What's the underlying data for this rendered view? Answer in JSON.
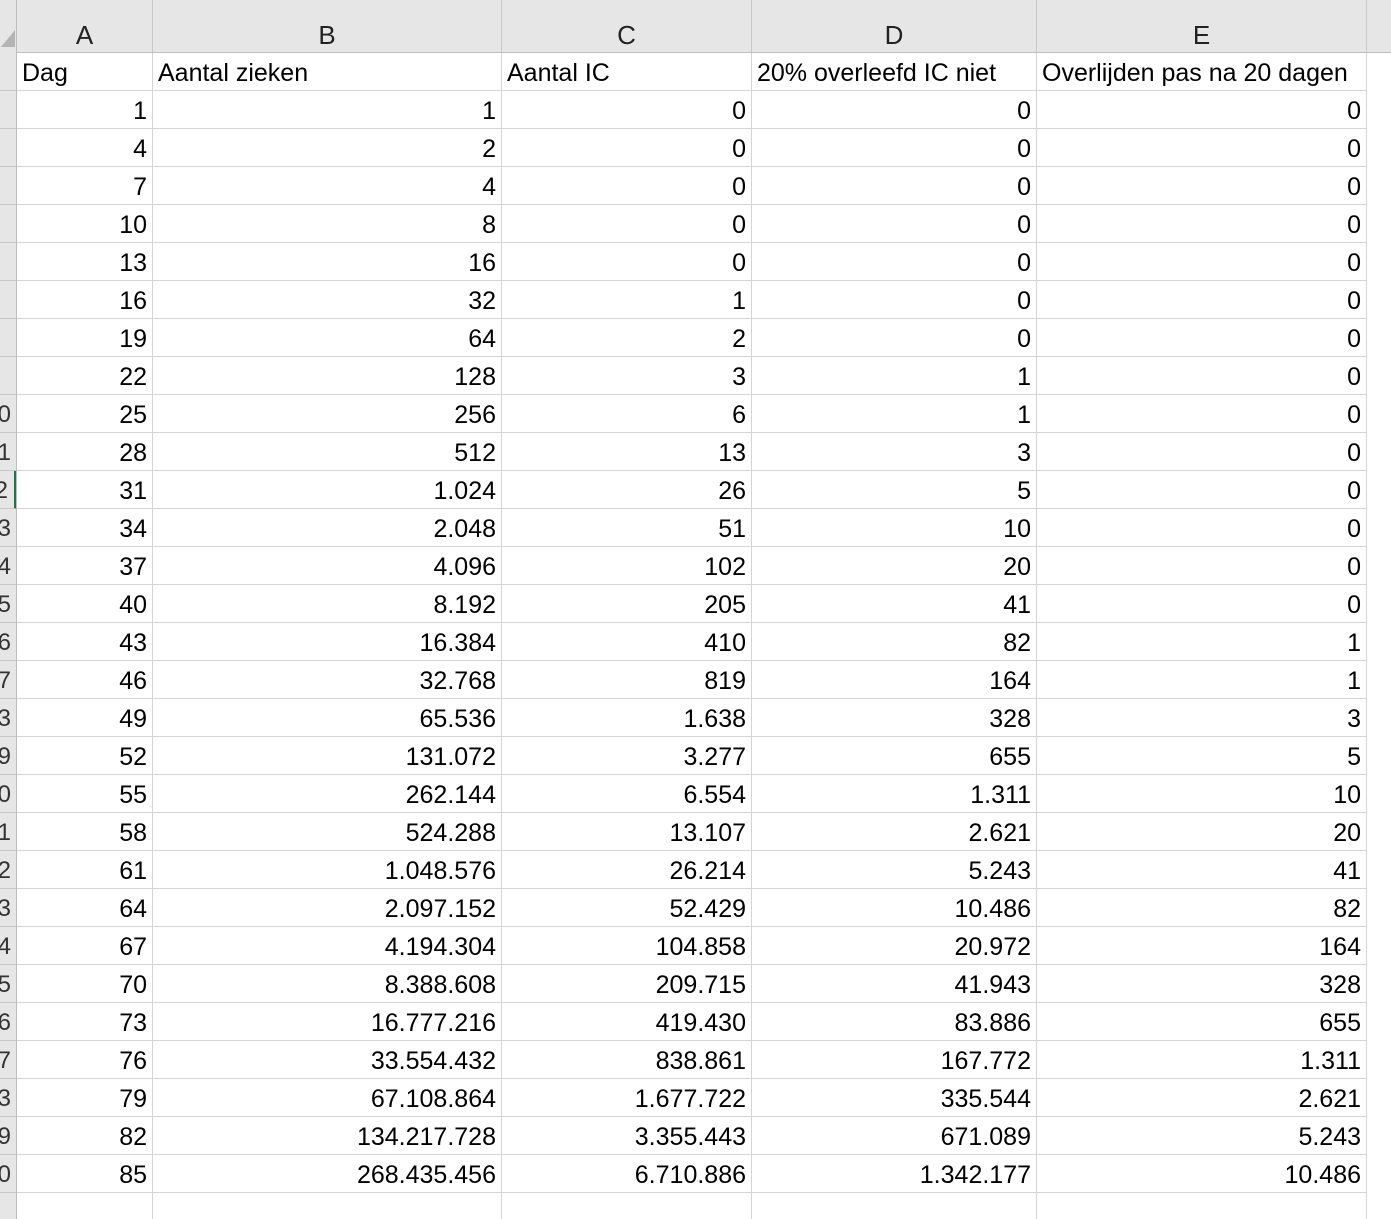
{
  "columns": [
    "A",
    "B",
    "C",
    "D",
    "E"
  ],
  "headers": [
    "Dag",
    "Aantal zieken",
    "Aantal IC",
    "20% overleefd IC niet",
    "Overlijden pas na 20 dagen"
  ],
  "row_labels": [
    "",
    "",
    "",
    "",
    "",
    "",
    "",
    "",
    "",
    "0",
    "1",
    "2",
    "3",
    "4",
    "5",
    "6",
    "7",
    "3",
    "9",
    "0",
    "1",
    "2",
    "3",
    "4",
    "5",
    "6",
    "7",
    "3",
    "9",
    "0",
    "",
    ""
  ],
  "active_row_index": 11,
  "rows": [
    [
      "1",
      "1",
      "0",
      "0",
      "0"
    ],
    [
      "4",
      "2",
      "0",
      "0",
      "0"
    ],
    [
      "7",
      "4",
      "0",
      "0",
      "0"
    ],
    [
      "10",
      "8",
      "0",
      "0",
      "0"
    ],
    [
      "13",
      "16",
      "0",
      "0",
      "0"
    ],
    [
      "16",
      "32",
      "1",
      "0",
      "0"
    ],
    [
      "19",
      "64",
      "2",
      "0",
      "0"
    ],
    [
      "22",
      "128",
      "3",
      "1",
      "0"
    ],
    [
      "25",
      "256",
      "6",
      "1",
      "0"
    ],
    [
      "28",
      "512",
      "13",
      "3",
      "0"
    ],
    [
      "31",
      "1.024",
      "26",
      "5",
      "0"
    ],
    [
      "34",
      "2.048",
      "51",
      "10",
      "0"
    ],
    [
      "37",
      "4.096",
      "102",
      "20",
      "0"
    ],
    [
      "40",
      "8.192",
      "205",
      "41",
      "0"
    ],
    [
      "43",
      "16.384",
      "410",
      "82",
      "1"
    ],
    [
      "46",
      "32.768",
      "819",
      "164",
      "1"
    ],
    [
      "49",
      "65.536",
      "1.638",
      "328",
      "3"
    ],
    [
      "52",
      "131.072",
      "3.277",
      "655",
      "5"
    ],
    [
      "55",
      "262.144",
      "6.554",
      "1.311",
      "10"
    ],
    [
      "58",
      "524.288",
      "13.107",
      "2.621",
      "20"
    ],
    [
      "61",
      "1.048.576",
      "26.214",
      "5.243",
      "41"
    ],
    [
      "64",
      "2.097.152",
      "52.429",
      "10.486",
      "82"
    ],
    [
      "67",
      "4.194.304",
      "104.858",
      "20.972",
      "164"
    ],
    [
      "70",
      "8.388.608",
      "209.715",
      "41.943",
      "328"
    ],
    [
      "73",
      "16.777.216",
      "419.430",
      "83.886",
      "655"
    ],
    [
      "76",
      "33.554.432",
      "838.861",
      "167.772",
      "1.311"
    ],
    [
      "79",
      "67.108.864",
      "1.677.722",
      "335.544",
      "2.621"
    ],
    [
      "82",
      "134.217.728",
      "3.355.443",
      "671.089",
      "5.243"
    ],
    [
      "85",
      "268.435.456",
      "6.710.886",
      "1.342.177",
      "10.486"
    ]
  ]
}
